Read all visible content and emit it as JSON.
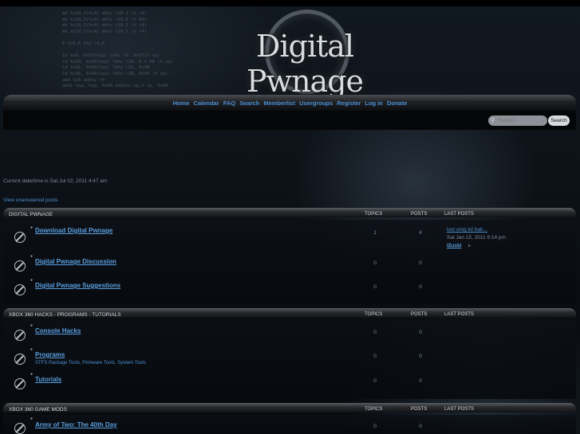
{
  "header": {
    "logo_text": "Digital Pwnage",
    "code_lines": "mk %v28,1(%c4) mk%v r28.1 (% r4)\nmb %v28,3(%c4) mb%v r28.3 (% B4)\nmb %v28,5(%c4) mk%v r28.5 (% r4)\nmb %v29,7(%c4) mk%v r28.7 (% r4)\n\nE %v8,E b%v r3,8\n\nld %v0, 0xC0(%sp) ld%v r0, 0xC0(% sp)\nld %v28, 0x08(%sp) ld%v r28, 0 x 08 (% sp)\nld %v31, 0x48(%sp) ld%v r31, 0x48\nld %v30, 0x40(%sp) ld%v r30, 0x40 (% sp)\nadd %v0 add%v r0\naddi %sp, %sp, 0x80 addi%v sp,% sp, 0x80\n\nBLR"
  },
  "nav": {
    "items": [
      "Home",
      "Calendar",
      "FAQ",
      "Search",
      "Memberlist",
      "Usergroups",
      "Register",
      "Log in",
      "Donate"
    ]
  },
  "search": {
    "placeholder": "Search...",
    "button_label": "Search"
  },
  "datetime": "Current date/time is Sat Jul 02, 2011 4:47 am",
  "unanswered_link": "View unanswered posts",
  "columns": {
    "topics": "TOPICS",
    "posts": "POSTS",
    "last_posts": "LAST POSTS"
  },
  "categories": [
    {
      "title": "DIGITAL PWNAGE",
      "forums": [
        {
          "title": "Download Digital Pwnage",
          "desc": "",
          "topics": "1",
          "posts": "4",
          "last_post": {
            "title": "lost omg lol hah...",
            "date": "Sat Jan 15, 2011 9:14 pm",
            "user": "l2uski"
          }
        },
        {
          "title": "Digital Pwnage Discussion",
          "desc": "",
          "topics": "0",
          "posts": "0"
        },
        {
          "title": "Digital Pwnage Suggestions",
          "desc": "",
          "topics": "0",
          "posts": "0"
        }
      ]
    },
    {
      "title": "XBOX 360 HACKS - PROGRAMS - TUTORIALS",
      "forums": [
        {
          "title": "Console Hacks",
          "desc": "",
          "topics": "0",
          "posts": "0"
        },
        {
          "title": "Programs",
          "desc": "STFS Package Tools, Firmware Tools, System Tools",
          "topics": "0",
          "posts": "0"
        },
        {
          "title": "Tutorials",
          "desc": "",
          "topics": "0",
          "posts": "0"
        }
      ]
    },
    {
      "title": "XBOX 360 GAME MODS",
      "forums": [
        {
          "title": "Army of Two: The 40th Day",
          "desc": "",
          "topics": "0",
          "posts": "0"
        }
      ]
    }
  ]
}
